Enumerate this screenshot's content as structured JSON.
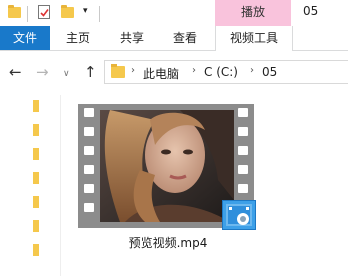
{
  "titlebar": {
    "quick_access": [
      "folder-icon",
      "properties-check-icon",
      "new-folder-icon",
      "customize-dropdown-icon"
    ],
    "context_tab": "播放",
    "title": "05"
  },
  "ribbon": {
    "file_tab": "文件",
    "tabs": [
      "主页",
      "共享",
      "查看"
    ],
    "context_tool_tab": "视频工具",
    "colors": {
      "file_tab": "#1979ca",
      "context_tab": "#f9c3dc"
    }
  },
  "nav": {
    "back": "←",
    "forward": "→",
    "recent": "∨",
    "up": "↑"
  },
  "address": {
    "breadcrumbs": [
      "此电脑",
      "C (C:)",
      "05"
    ],
    "separator": "›"
  },
  "file": {
    "name": "预览视频.mp4",
    "thumbnail": "filmstrip-video-thumbnail-portrait",
    "badge_color": "#3da0e8"
  }
}
